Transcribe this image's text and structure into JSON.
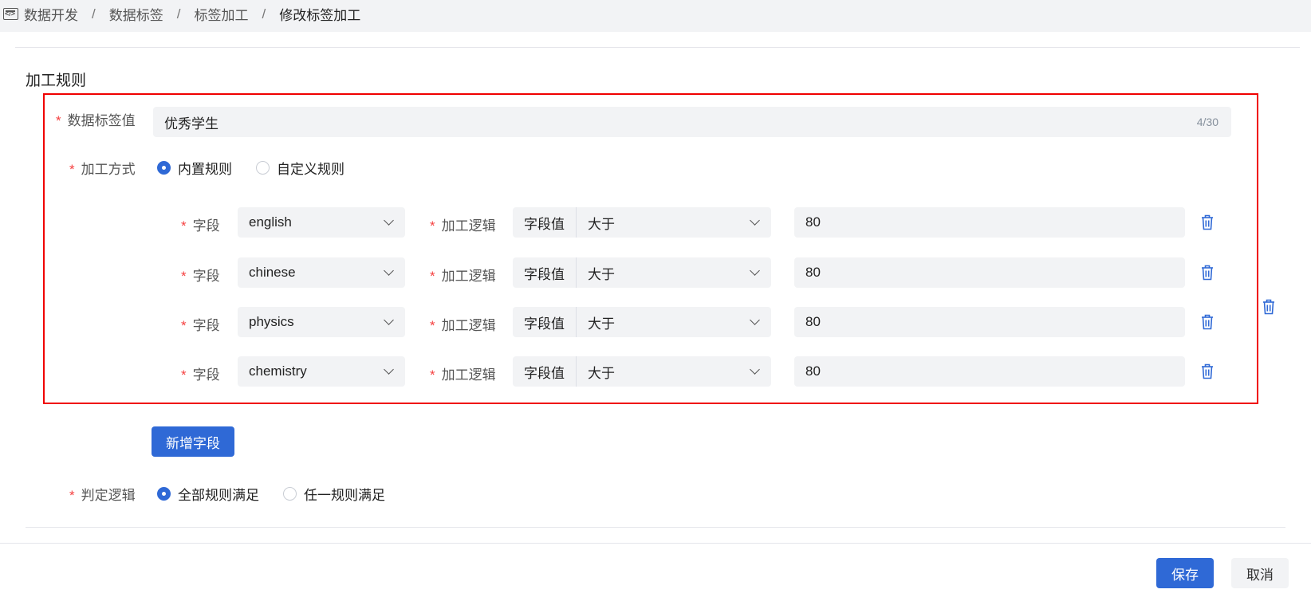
{
  "breadcrumb": {
    "icon": "code-window-icon",
    "items": [
      "数据开发",
      "数据标签",
      "标签加工",
      "修改标签加工"
    ],
    "separator": "/"
  },
  "section": {
    "title": "加工规则"
  },
  "form": {
    "required_mark": "*",
    "tag_value": {
      "label": "数据标签值",
      "value": "优秀学生",
      "count": "4/30"
    },
    "method": {
      "label": "加工方式",
      "options": [
        "内置规则",
        "自定义规则"
      ],
      "selected": "内置规则"
    },
    "rules": [
      {
        "field_label": "字段",
        "field": "english",
        "logic_label": "加工逻辑",
        "logic_prefix": "字段值",
        "operator": "大于",
        "value": "80"
      },
      {
        "field_label": "字段",
        "field": "chinese",
        "logic_label": "加工逻辑",
        "logic_prefix": "字段值",
        "operator": "大于",
        "value": "80"
      },
      {
        "field_label": "字段",
        "field": "physics",
        "logic_label": "加工逻辑",
        "logic_prefix": "字段值",
        "operator": "大于",
        "value": "80"
      },
      {
        "field_label": "字段",
        "field": "chemistry",
        "logic_label": "加工逻辑",
        "logic_prefix": "字段值",
        "operator": "大于",
        "value": "80"
      }
    ],
    "add_field_label": "新增字段",
    "judgement": {
      "label": "判定逻辑",
      "options": [
        "全部规则满足",
        "任一规则满足"
      ],
      "selected": "全部规则满足"
    }
  },
  "footer": {
    "save_label": "保存",
    "cancel_label": "取消"
  },
  "colors": {
    "primary": "#2f69d6",
    "required": "#f53f3f",
    "highlight": "#f00000"
  }
}
